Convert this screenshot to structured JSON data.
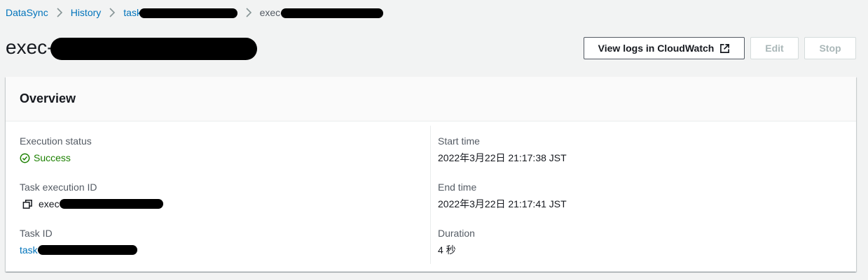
{
  "breadcrumb": {
    "items": [
      {
        "label": "DataSync"
      },
      {
        "label": "History"
      },
      {
        "label": "task-"
      },
      {
        "label": "exec-"
      }
    ]
  },
  "header": {
    "title": "exec-"
  },
  "actions": {
    "view_logs_label": "View logs in CloudWatch",
    "edit_label": "Edit",
    "stop_label": "Stop"
  },
  "overview": {
    "title": "Overview",
    "left": {
      "execution_status_label": "Execution status",
      "execution_status_value": "Success",
      "task_execution_id_label": "Task execution ID",
      "task_execution_id_value": "exec-",
      "task_id_label": "Task ID",
      "task_id_value": "task-"
    },
    "right": {
      "start_time_label": "Start time",
      "start_time_value": "2022年3月22日 21:17:38 JST",
      "end_time_label": "End time",
      "end_time_value": "2022年3月22日 21:17:41 JST",
      "duration_label": "Duration",
      "duration_value": "4 秒"
    }
  },
  "colors": {
    "link": "#0073bb",
    "success": "#1d8102",
    "text": "#16191f",
    "label": "#545b64",
    "background": "#f2f3f3"
  },
  "icons": {
    "separator": "chevron-right-icon",
    "external": "external-link-icon",
    "status": "status-success-icon",
    "copy": "copy-icon"
  }
}
